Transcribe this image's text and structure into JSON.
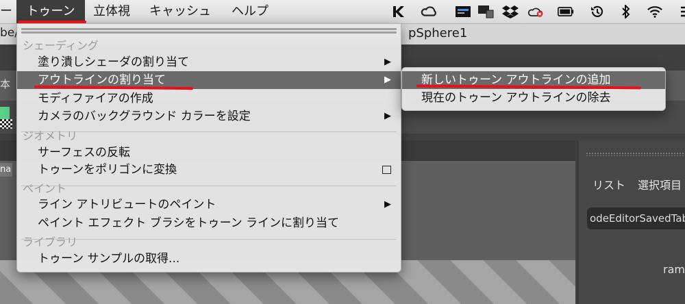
{
  "menubar": {
    "app_menu_fragment": "ー",
    "items": [
      "トゥーン",
      "立体視",
      "キャッシュ",
      "ヘルプ"
    ],
    "active_item": "トゥーン"
  },
  "tray_icons": [
    "k-icon",
    "creative-cloud-icon",
    "display-icon",
    "monitor-icon",
    "dropbox-icon",
    "cloud-error-icon",
    "battery-icon",
    "time-machine-icon",
    "bluetooth-icon",
    "wifi-icon"
  ],
  "background": {
    "title_left": "be/",
    "object_name": "pSphere1",
    "left_label": "本",
    "viewport_label": "na",
    "panel": {
      "list_label": "リスト",
      "selection_label": "選択項目",
      "tab_field": "odeEditorSavedTab",
      "ramp_label": "ramp"
    }
  },
  "menu": {
    "sections": {
      "shading": "シェーディング",
      "geometry": "ジオメトリ",
      "paint": "ペイント",
      "library": "ライブラリ"
    },
    "items": {
      "assign_fill_shader": "塗り潰しシェーダの割り当て",
      "assign_outline": "アウトラインの割り当て",
      "create_modifier": "モディファイアの作成",
      "set_camera_background": "カメラのバックグラウンド カラーを設定",
      "reverse_surfaces": "サーフェスの反転",
      "toon_to_polygons": "トゥーンをポリゴンに変換",
      "paint_line_attributes": "ライン アトリビュートのペイント",
      "assign_paint_effects_brush": "ペイント エフェクト ブラシをトゥーン ラインに割り当て",
      "get_toon_example": "トゥーン サンプルの取得..."
    },
    "arrow_glyph": "▶"
  },
  "submenu": {
    "items": [
      "新しいトゥーン アウトラインの追加",
      "現在のトゥーン アウトラインの除去"
    ]
  },
  "annotation_color": "#e8101c"
}
